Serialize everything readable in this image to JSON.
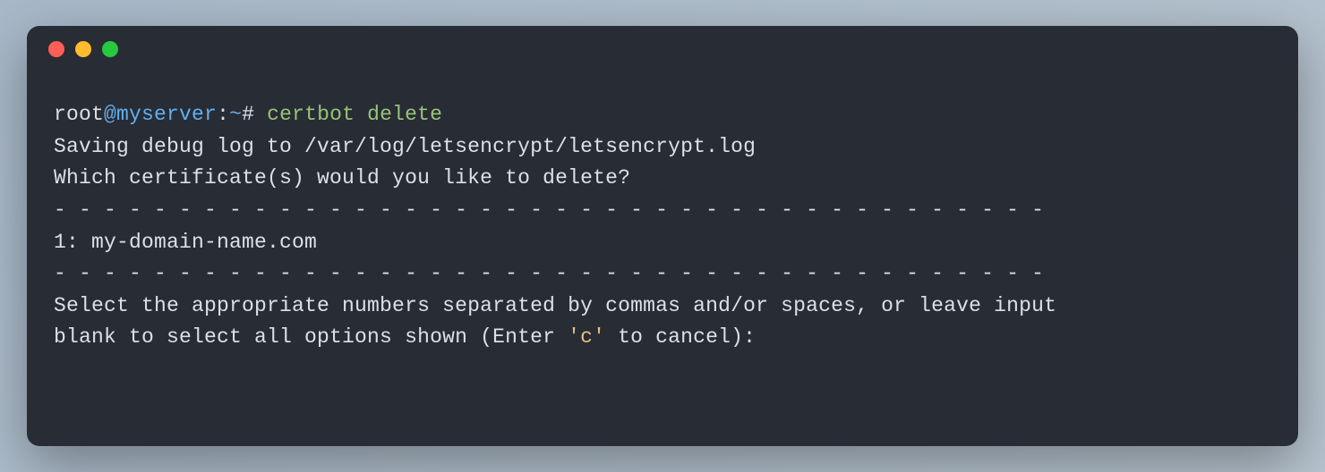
{
  "window": {
    "traffic_lights": [
      "red",
      "yellow",
      "green"
    ]
  },
  "prompt": {
    "user": "root",
    "at": "@",
    "host": "myserver",
    "sep1": ":",
    "path": "~",
    "sep2": "#",
    "command": "certbot delete"
  },
  "lines": {
    "log_line": "Saving debug log to /var/log/letsencrypt/letsencrypt.log",
    "blank1": "",
    "question": "Which certificate(s) would you like to delete?",
    "dash_row": "- - - - - - - - - - - - - - - - - - - - - - - - - - - - - - - - - - - - - - - -",
    "cert_item": "1: my-domain-name.com",
    "dash_row2": "- - - - - - - - - - - - - - - - - - - - - - - - - - - - - - - - - - - - - - - -",
    "select_pre": "Select the appropriate numbers separated by commas and/or spaces, or leave input",
    "select_blank_pre": "blank to select all options shown (Enter ",
    "select_quoted": "'c'",
    "select_post": " to cancel):"
  }
}
